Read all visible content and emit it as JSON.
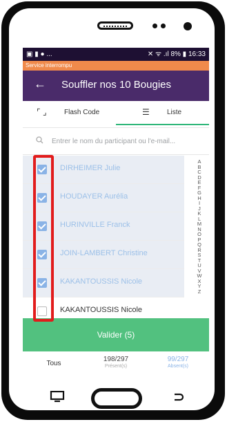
{
  "status_bar": {
    "left_icons": "▣ ▮ ●  ...",
    "right_text": "✕ ᯤ .ıl 8% ▮ 16:33"
  },
  "notice": {
    "text": "Service interrompu"
  },
  "app_bar": {
    "back_glyph": "←",
    "title": "Souffler nos 10 Bougies"
  },
  "tabs": [
    {
      "icon": "⌜ ⌟",
      "label": "Flash Code",
      "active": false
    },
    {
      "icon": "☰",
      "label": "Liste",
      "active": true
    }
  ],
  "search": {
    "placeholder": "Entrer le nom du participant ou l'e-mail..."
  },
  "participants": [
    {
      "name": "DIRHEIMER Julie",
      "checked": true
    },
    {
      "name": "HOUDAYER Aurélia",
      "checked": true
    },
    {
      "name": "HURINVILLE Franck",
      "checked": true
    },
    {
      "name": "JOIN-LAMBERT Christine",
      "checked": true
    },
    {
      "name": "KAKANTOUSSIS Nicole",
      "checked": true
    },
    {
      "name": "KAKANTOUSSIS Nicole",
      "checked": false
    }
  ],
  "alphabet": [
    "A",
    "B",
    "C",
    "D",
    "E",
    "F",
    "G",
    "H",
    "I",
    "J",
    "K",
    "L",
    "M",
    "N",
    "O",
    "P",
    "Q",
    "R",
    "S",
    "T",
    "U",
    "V",
    "W",
    "X",
    "Y",
    "Z"
  ],
  "validate_button": {
    "label": "Valider (5)"
  },
  "footer": {
    "all_label": "Tous",
    "present_count": "198/297",
    "present_label": "Présent(s)",
    "absent_count": "99/297",
    "absent_label": "Absent(s)"
  },
  "colors": {
    "status_bar": "#1e1033",
    "notice": "#f08a4b",
    "app_bar": "#4a2b6a",
    "accent_green": "#52c17f",
    "checkbox_blue": "#8ab3e6",
    "highlight_red": "#e21c1c"
  }
}
